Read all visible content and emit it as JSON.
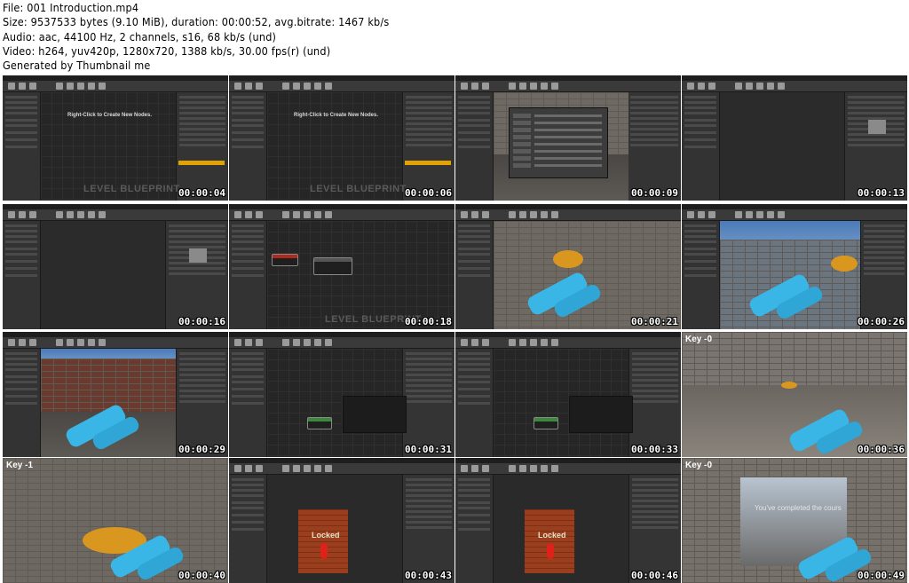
{
  "header": {
    "file": "File: 001 Introduction.mp4",
    "size": "Size: 9537533 bytes (9.10 MiB), duration: 00:00:52, avg.bitrate: 1467 kb/s",
    "audio": "Audio: aac, 44100 Hz, 2 channels, s16, 68 kb/s (und)",
    "video": "Video: h264, yuv420p, 1280x720, 1388 kb/s, 30.00 fps(r) (und)",
    "generated": "Generated by Thumbnail me"
  },
  "thumbnails": [
    {
      "timestamp": "00:00:04",
      "scene": "level-blueprint",
      "watermark": "LEVEL BLUEPRINT",
      "hint": "Right-Click to Create New Nodes."
    },
    {
      "timestamp": "00:00:06",
      "scene": "level-blueprint",
      "watermark": "LEVEL BLUEPRINT",
      "hint": "Right-Click to Create New Nodes."
    },
    {
      "timestamp": "00:00:09",
      "scene": "dialog-viewport"
    },
    {
      "timestamp": "00:00:13",
      "scene": "details-editor"
    },
    {
      "timestamp": "00:00:16",
      "scene": "details-editor"
    },
    {
      "timestamp": "00:00:18",
      "scene": "level-blueprint-nodes",
      "watermark": "LEVEL BLUEPRINT"
    },
    {
      "timestamp": "00:00:21",
      "scene": "viewport-wall-disk"
    },
    {
      "timestamp": "00:00:26",
      "scene": "viewport-grate"
    },
    {
      "timestamp": "00:00:29",
      "scene": "viewport-corridor"
    },
    {
      "timestamp": "00:00:31",
      "scene": "blueprint-graph"
    },
    {
      "timestamp": "00:00:33",
      "scene": "blueprint-graph"
    },
    {
      "timestamp": "00:00:36",
      "scene": "game-floor",
      "key": "Key -0"
    },
    {
      "timestamp": "00:00:40",
      "scene": "game-disk-close",
      "key": "Key -1"
    },
    {
      "timestamp": "00:00:43",
      "scene": "door-locked",
      "door_text": "Locked"
    },
    {
      "timestamp": "00:00:46",
      "scene": "door-locked",
      "door_text": "Locked"
    },
    {
      "timestamp": "00:00:49",
      "scene": "game-exit",
      "key": "Key -0",
      "message": "You've completed the cours"
    }
  ],
  "colors": {
    "editor_bg": "#262626",
    "panel_bg": "#343434",
    "gun_blue": "#3ab6e6",
    "disk_orange": "#d9971f",
    "door_red": "#9a3e1d"
  }
}
